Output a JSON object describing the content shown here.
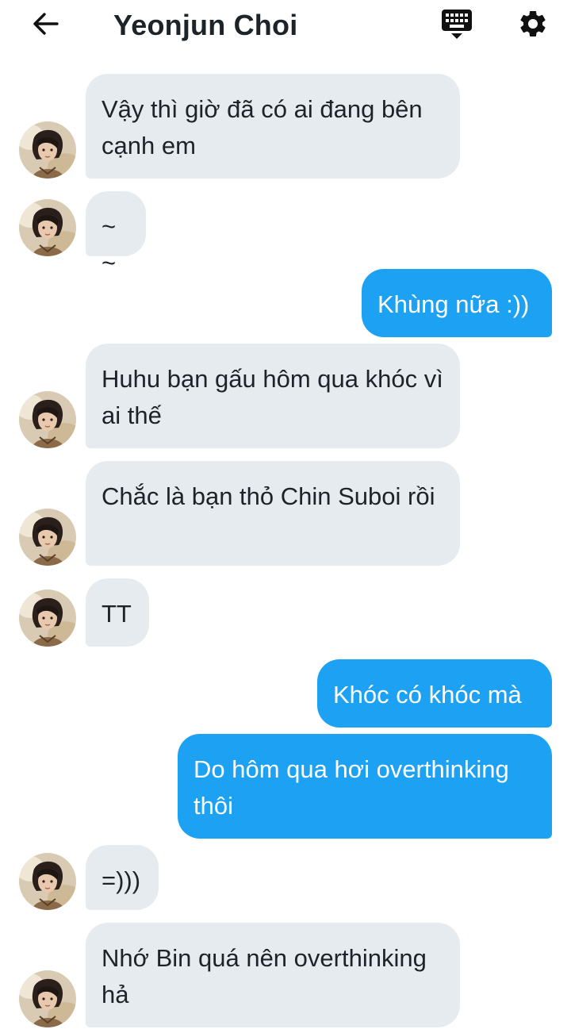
{
  "header": {
    "title": "Yeonjun Choi",
    "back_icon": "arrow-left-icon",
    "keyboard_icon": "keyboard-icon",
    "settings_icon": "gear-icon"
  },
  "colors": {
    "incoming_bubble": "#e6ebf0",
    "outgoing_bubble": "#1da1f2",
    "text": "#1c2329"
  },
  "messages": [
    {
      "side": "in",
      "text": "Vậy thì giờ đã có ai đang bên cạnh em"
    },
    {
      "side": "in",
      "text": "~~"
    },
    {
      "side": "out",
      "text": "Khùng nữa :))"
    },
    {
      "side": "in",
      "text": "Huhu bạn gấu hôm qua khóc vì ai thế"
    },
    {
      "side": "in",
      "text": "Chắc là bạn thỏ Chin Suboi rồi"
    },
    {
      "side": "in",
      "text": "TT"
    },
    {
      "side": "out",
      "text": "Khóc có khóc mà"
    },
    {
      "side": "out",
      "text": "Do hôm qua hơi overthinking thôi"
    },
    {
      "side": "in",
      "text": "=)))"
    },
    {
      "side": "in",
      "text": "Nhớ Bin quá nên overthinking hả"
    }
  ]
}
